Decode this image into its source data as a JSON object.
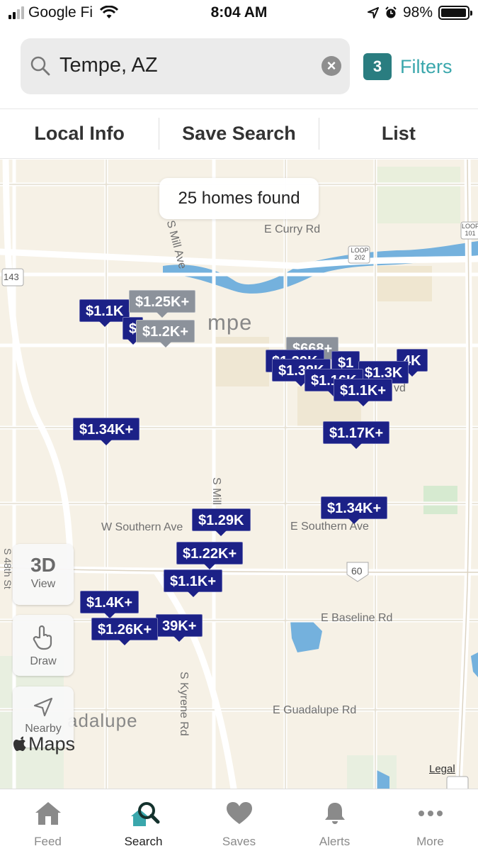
{
  "status_bar": {
    "carrier": "Google Fi",
    "time": "8:04 AM",
    "battery": "98%",
    "battery_level": 0.98
  },
  "search": {
    "value": "Tempe, AZ",
    "filters_count": "3",
    "filters_label": "Filters"
  },
  "tabs": [
    {
      "label": "Local Info"
    },
    {
      "label": "Save Search"
    },
    {
      "label": "List"
    }
  ],
  "map": {
    "results_text": "25 homes found",
    "labels": {
      "curry": "E Curry Rd",
      "mill_top": "S Mill Ave",
      "city": "mpe",
      "mill": "S Mill",
      "southern_w": "W Southern Ave",
      "southern_e": "E Southern Ave",
      "baseline": "E Baseline Rd",
      "kyrene": "S Kyrene Rd",
      "guadalupe_rd": "E Guadalupe Rd",
      "guadalupe": "adalupe",
      "st48": "S 48th St",
      "loop202": "LOOP 202",
      "hwy143": "143",
      "hwy60": "60",
      "loop101": "LOOP 101",
      "rd_partial": "vd"
    },
    "pins": [
      {
        "label": "$1.1K",
        "style": "blue"
      },
      {
        "label": "$1.25K+",
        "style": "gray"
      },
      {
        "label": "$",
        "style": "blue"
      },
      {
        "label": "$1.2K+",
        "style": "gray"
      },
      {
        "label": "$668+",
        "style": "gray"
      },
      {
        "label": "$1.39K",
        "style": "blue"
      },
      {
        "label": "4K",
        "style": "blue"
      },
      {
        "label": "$1.38K",
        "style": "blue"
      },
      {
        "label": "$1",
        "style": "blue"
      },
      {
        "label": "$1.3K",
        "style": "blue"
      },
      {
        "label": "$1.16K",
        "style": "blue"
      },
      {
        "label": "$1.1K+",
        "style": "blue"
      },
      {
        "label": "$1.34K+",
        "style": "blue"
      },
      {
        "label": "$1.17K+",
        "style": "blue"
      },
      {
        "label": "$1.34K+",
        "style": "blue"
      },
      {
        "label": "$1.29K",
        "style": "blue"
      },
      {
        "label": "$1.22K+",
        "style": "blue"
      },
      {
        "label": "$1.1K+",
        "style": "blue"
      },
      {
        "label": "$1.4K+",
        "style": "blue"
      },
      {
        "label": "39K+",
        "style": "blue"
      },
      {
        "label": "$1.26K+",
        "style": "blue"
      }
    ],
    "controls": {
      "view_3d": {
        "big": "3D",
        "small": "View"
      },
      "draw": {
        "label": "Draw"
      },
      "nearby": {
        "label": "Nearby"
      }
    },
    "attribution": "Maps",
    "legal": "Legal"
  },
  "nav": [
    {
      "label": "Feed",
      "icon": "home-icon"
    },
    {
      "label": "Search",
      "icon": "search-home-icon",
      "active": true
    },
    {
      "label": "Saves",
      "icon": "heart-icon"
    },
    {
      "label": "Alerts",
      "icon": "bell-icon"
    },
    {
      "label": "More",
      "icon": "more-dots-icon"
    }
  ],
  "colors": {
    "accent": "#2a7d80",
    "filters": "#3aa7ac",
    "pin": "#1c2187",
    "pin_gray": "#8c929b",
    "map_bg": "#f6f1e6",
    "water": "#74b1dd"
  }
}
